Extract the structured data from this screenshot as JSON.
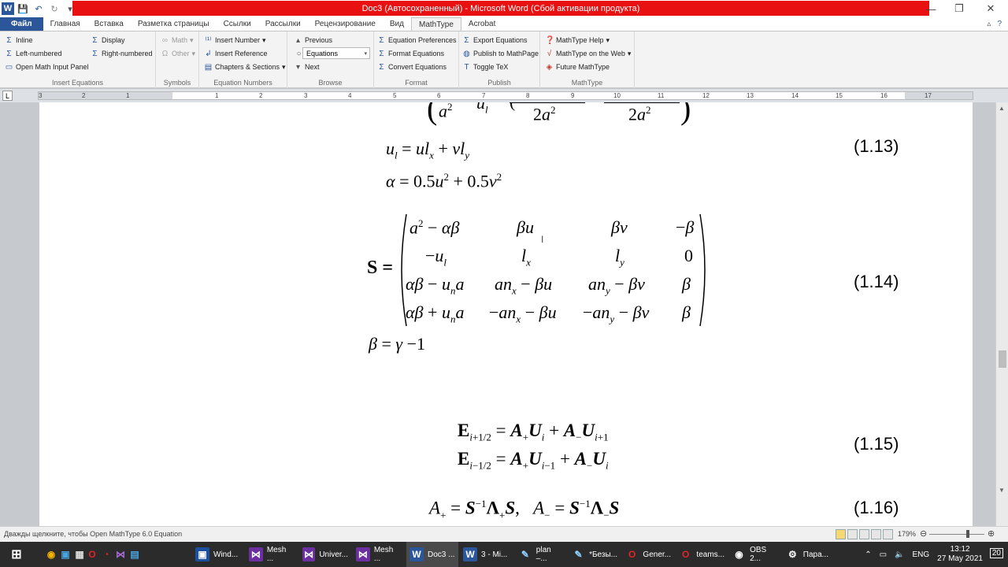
{
  "titlebar": {
    "title": "Doc3 (Автосохраненный) - Microsoft Word (Сбой активации продукта)",
    "logo": "W",
    "minimize": "—",
    "restore": "❐",
    "close": "✕"
  },
  "tabs": [
    {
      "label": "Файл"
    },
    {
      "label": "Главная"
    },
    {
      "label": "Вставка"
    },
    {
      "label": "Разметка страницы"
    },
    {
      "label": "Ссылки"
    },
    {
      "label": "Рассылки"
    },
    {
      "label": "Рецензирование"
    },
    {
      "label": "Вид"
    },
    {
      "label": "MathType"
    },
    {
      "label": "Acrobat"
    }
  ],
  "ribbon": {
    "insert_equations": {
      "inline": "Inline",
      "display": "Display",
      "left_numbered": "Left-numbered",
      "right_numbered": "Right-numbered",
      "open_panel": "Open Math Input Panel",
      "label": "Insert Equations"
    },
    "symbols": {
      "math": "Math",
      "other": "Other",
      "label": "Symbols"
    },
    "equation_numbers": {
      "insert_number": "Insert Number",
      "insert_reference": "Insert Reference",
      "chapters_sections": "Chapters & Sections",
      "label": "Equation Numbers"
    },
    "browse": {
      "previous": "Previous",
      "combo_value": "Equations",
      "next": "Next",
      "label": "Browse"
    },
    "format": {
      "equation_preferences": "Equation Preferences",
      "format_equations": "Format Equations",
      "convert_equations": "Convert Equations",
      "label": "Format"
    },
    "publish": {
      "export_equations": "Export Equations",
      "publish_mathpage": "Publish to MathPage",
      "toggle_tex": "Toggle TeX",
      "label": "Publish"
    },
    "mathtype": {
      "help": "MathType Help",
      "on_web": "MathType on the Web",
      "future": "Future MathType",
      "label": "MathType"
    }
  },
  "ruler": {
    "numbers": [
      "3",
      "2",
      "1",
      "1",
      "2",
      "3",
      "4",
      "5",
      "6",
      "7",
      "8",
      "9",
      "10",
      "11",
      "12",
      "13",
      "14",
      "15",
      "16",
      "17"
    ]
  },
  "document": {
    "eq_numbers": [
      "(1.13)",
      "(1.14)",
      "(1.15)",
      "(1.16)"
    ]
  },
  "status": {
    "text": "Дважды щелкните, чтобы Open MathType 6.0 Equation",
    "zoom": "179%"
  },
  "taskbar": {
    "items": [
      {
        "label": "Wind...",
        "icon": "W"
      },
      {
        "label": "Mesh ...",
        "icon": "V"
      },
      {
        "label": "Univer...",
        "icon": "V"
      },
      {
        "label": "Mesh ...",
        "icon": "V"
      },
      {
        "label": "Doc3 ...",
        "icon": "W"
      },
      {
        "label": "3 - Mi...",
        "icon": "W"
      },
      {
        "label": "plan –...",
        "icon": "N"
      },
      {
        "label": "*Безы...",
        "icon": "N"
      },
      {
        "label": "Gener...",
        "icon": "O"
      },
      {
        "label": "teams...",
        "icon": "O"
      },
      {
        "label": "OBS 2...",
        "icon": "◉"
      },
      {
        "label": "Пара...",
        "icon": "⚙"
      }
    ],
    "lang": "ENG",
    "time": "13:12",
    "date": "27 May 2021",
    "notification_count": "20"
  }
}
